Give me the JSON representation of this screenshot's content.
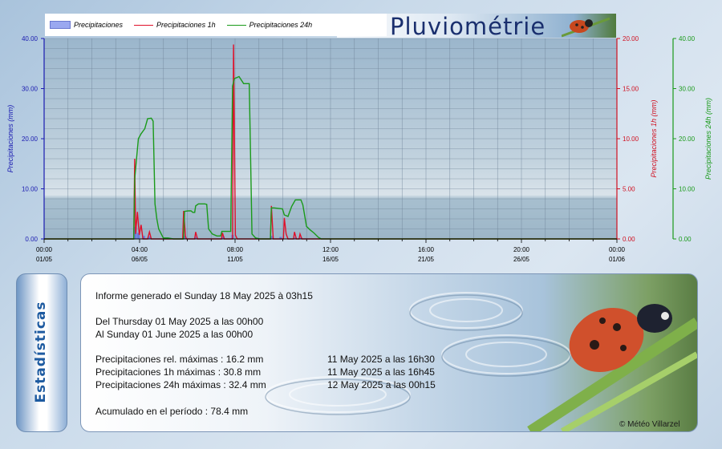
{
  "page": {
    "title": "Pluviométrie"
  },
  "legend": [
    {
      "label": "Precipitaciones",
      "kind": "bar",
      "color": "#6070e0"
    },
    {
      "label": "Precipitaciones 1h",
      "kind": "line",
      "color": "#e0102a"
    },
    {
      "label": "Precipitaciones 24h",
      "kind": "line",
      "color": "#1a9a1a"
    }
  ],
  "chart_data": {
    "type": "line",
    "grid": true,
    "legend_placement": "top-left",
    "x_ticks": [
      {
        "time": "00:00",
        "date": "01/05"
      },
      {
        "time": "04:00",
        "date": "06/05"
      },
      {
        "time": "08:00",
        "date": "11/05"
      },
      {
        "time": "12:00",
        "date": "16/05"
      },
      {
        "time": "16:00",
        "date": "21/05"
      },
      {
        "time": "20:00",
        "date": "26/05"
      },
      {
        "time": "00:00",
        "date": "01/06"
      }
    ],
    "xlim": [
      0,
      31
    ],
    "axes": {
      "left": {
        "label": "Precipitaciones (mm)",
        "ylim": [
          0,
          40
        ],
        "ticks": [
          "0.00",
          "10.00",
          "20.00",
          "30.00",
          "40.00"
        ],
        "color": "#1a1ab0"
      },
      "right1": {
        "label": "Precipitaciones 1h (mm)",
        "ylim": [
          0,
          20
        ],
        "ticks": [
          "0.00",
          "5.00",
          "10.00",
          "15.00",
          "20.00"
        ],
        "color": "#d01020"
      },
      "right2": {
        "label": "Precipitaciones 24h (mm)",
        "ylim": [
          0,
          40
        ],
        "ticks": [
          "0.00",
          "10.00",
          "20.00",
          "30.00",
          "40.00"
        ],
        "color": "#1a9a1a"
      }
    },
    "series": [
      {
        "name": "Precipitaciones",
        "axis": "left",
        "style": "bars",
        "color": "#6070e0",
        "points": [
          [
            4.95,
            2.4
          ],
          [
            5.1,
            1.2
          ],
          [
            5.4,
            0.6
          ],
          [
            5.7,
            0.5
          ],
          [
            7.6,
            0.6
          ],
          [
            8.2,
            0.4
          ],
          [
            9.7,
            0.5
          ],
          [
            10.2,
            0.8
          ],
          [
            12.3,
            0.6
          ],
          [
            12.8,
            0.4
          ],
          [
            13.6,
            0.3
          ],
          [
            13.9,
            0.3
          ]
        ]
      },
      {
        "name": "Precipitaciones 1h",
        "axis": "right1",
        "style": "line",
        "color": "#e0102a",
        "points": [
          [
            0,
            0
          ],
          [
            4.85,
            0
          ],
          [
            4.9,
            8.0
          ],
          [
            4.95,
            0.5
          ],
          [
            5.05,
            2.7
          ],
          [
            5.15,
            0.4
          ],
          [
            5.25,
            1.4
          ],
          [
            5.35,
            0
          ],
          [
            5.6,
            0
          ],
          [
            5.7,
            0.7
          ],
          [
            5.8,
            0
          ],
          [
            7.5,
            0
          ],
          [
            7.55,
            2.8
          ],
          [
            7.65,
            0.3
          ],
          [
            7.7,
            0
          ],
          [
            8.15,
            0
          ],
          [
            8.2,
            0.7
          ],
          [
            8.3,
            0
          ],
          [
            9.6,
            0
          ],
          [
            9.65,
            0.6
          ],
          [
            9.75,
            0
          ],
          [
            10.2,
            0
          ],
          [
            10.25,
            19.4
          ],
          [
            10.35,
            0.4
          ],
          [
            10.45,
            0
          ],
          [
            12.25,
            0
          ],
          [
            12.3,
            3.3
          ],
          [
            12.4,
            0
          ],
          [
            12.95,
            0
          ],
          [
            13.0,
            2.1
          ],
          [
            13.1,
            0.5
          ],
          [
            13.2,
            0
          ],
          [
            13.5,
            0
          ],
          [
            13.55,
            0.7
          ],
          [
            13.65,
            0
          ],
          [
            13.8,
            0
          ],
          [
            13.85,
            0.5
          ],
          [
            13.95,
            0
          ],
          [
            31,
            0
          ]
        ]
      },
      {
        "name": "Precipitaciones 24h",
        "axis": "right2",
        "style": "line",
        "color": "#1a9a1a",
        "points": [
          [
            0,
            0
          ],
          [
            4.85,
            0
          ],
          [
            4.9,
            12.0
          ],
          [
            5.0,
            16.0
          ],
          [
            5.1,
            20.0
          ],
          [
            5.25,
            21.0
          ],
          [
            5.45,
            22.0
          ],
          [
            5.6,
            24.0
          ],
          [
            5.8,
            24.1
          ],
          [
            5.9,
            23.5
          ],
          [
            6.0,
            7.0
          ],
          [
            6.1,
            4.0
          ],
          [
            6.2,
            2.0
          ],
          [
            6.45,
            0.2
          ],
          [
            6.7,
            0.2
          ],
          [
            7.0,
            0
          ],
          [
            7.55,
            0
          ],
          [
            7.6,
            5.5
          ],
          [
            7.8,
            5.6
          ],
          [
            7.95,
            5.6
          ],
          [
            8.05,
            5.3
          ],
          [
            8.15,
            5.3
          ],
          [
            8.2,
            6.6
          ],
          [
            8.35,
            7.0
          ],
          [
            8.7,
            7.0
          ],
          [
            8.8,
            6.9
          ],
          [
            8.9,
            2.0
          ],
          [
            9.1,
            1.0
          ],
          [
            9.35,
            0.6
          ],
          [
            9.55,
            0.6
          ],
          [
            9.62,
            1.5
          ],
          [
            9.75,
            1.5
          ],
          [
            10.1,
            1.5
          ],
          [
            10.2,
            30.5
          ],
          [
            10.3,
            32.0
          ],
          [
            10.55,
            32.4
          ],
          [
            10.8,
            31.0
          ],
          [
            11.1,
            31.0
          ],
          [
            11.25,
            1.0
          ],
          [
            11.45,
            0.2
          ],
          [
            11.7,
            0
          ],
          [
            12.25,
            0
          ],
          [
            12.3,
            6.2
          ],
          [
            12.45,
            6.2
          ],
          [
            12.9,
            6.0
          ],
          [
            13.0,
            4.8
          ],
          [
            13.2,
            4.5
          ],
          [
            13.4,
            6.5
          ],
          [
            13.6,
            7.8
          ],
          [
            13.9,
            7.8
          ],
          [
            14.0,
            6.8
          ],
          [
            14.2,
            2.5
          ],
          [
            14.4,
            1.8
          ],
          [
            14.6,
            1.2
          ],
          [
            14.85,
            0.3
          ],
          [
            15.0,
            0
          ],
          [
            31,
            0
          ]
        ]
      }
    ]
  },
  "stats": {
    "tab_label": "Estadísticas",
    "generated": "Informe generado el Sunday 18 May 2025 à 03h15",
    "from": "Del Thursday 01 May 2025 a las 00h00",
    "to": "Al Sunday 01 June 2025 a las 00h00",
    "rows": [
      {
        "label": "Precipitaciones rel. máximas : 16.2 mm",
        "when": "11 May 2025 a las 16h30"
      },
      {
        "label": "Precipitaciones 1h máximas : 30.8 mm",
        "when": "11 May 2025 a las 16h45"
      },
      {
        "label": "Precipitaciones 24h máximas : 32.4 mm",
        "when": "12 May 2025 a las 00h15"
      }
    ],
    "total": "Acumulado en el período : 78.4 mm",
    "credit": "© Météo Villarzel"
  }
}
